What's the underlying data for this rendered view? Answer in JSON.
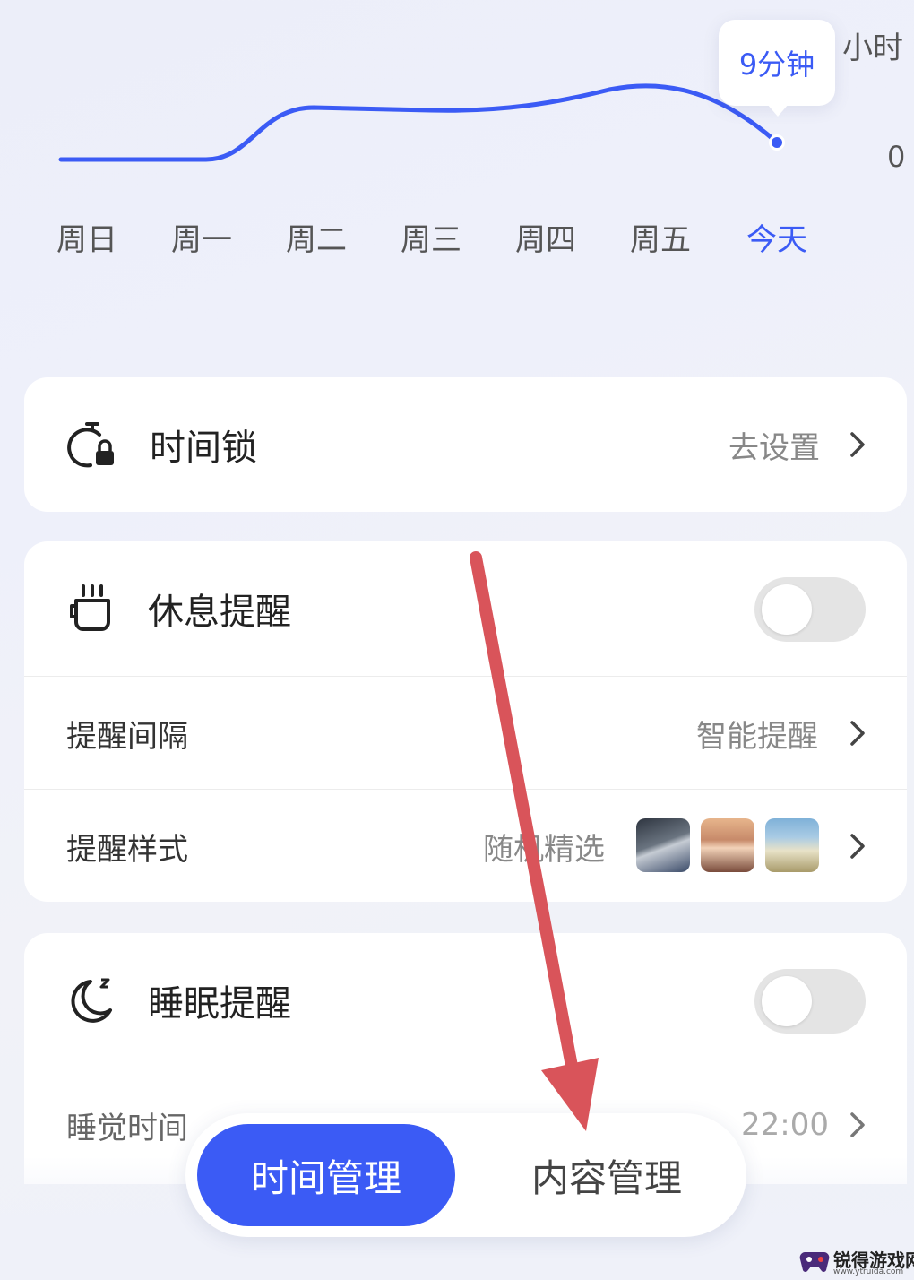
{
  "chart": {
    "unit": "小时",
    "zero": "0",
    "tooltip": "9分钟",
    "days": [
      "周日",
      "周一",
      "周二",
      "周三",
      "周四",
      "周五",
      "今天"
    ],
    "today_index": 6,
    "accent": "#3b5bf5"
  },
  "chart_data": {
    "type": "line",
    "categories": [
      "周日",
      "周一",
      "周二",
      "周三",
      "周四",
      "周五",
      "今天"
    ],
    "series": [
      {
        "values": [
          0,
          0,
          0.75,
          0.7,
          0.75,
          0.9,
          0.15
        ]
      }
    ],
    "ylabel": "小时"
  },
  "time_lock": {
    "icon": "stopwatch-lock-icon",
    "title": "时间锁",
    "value": "去设置"
  },
  "rest": {
    "icon": "coffee-cup-icon",
    "title": "休息提醒",
    "toggle_on": false,
    "interval_label": "提醒间隔",
    "interval_value": "智能提醒",
    "style_label": "提醒样式",
    "style_value": "随机精选"
  },
  "sleep": {
    "icon": "moon-zzz-icon",
    "title": "睡眠提醒",
    "toggle_on": false,
    "bedtime_label": "睡觉时间",
    "bedtime_value": "22:00"
  },
  "tabs": {
    "active": "时间管理",
    "inactive": "内容管理"
  },
  "watermark": {
    "brand": "锐得游戏网",
    "url": "www.ytruida.com"
  }
}
